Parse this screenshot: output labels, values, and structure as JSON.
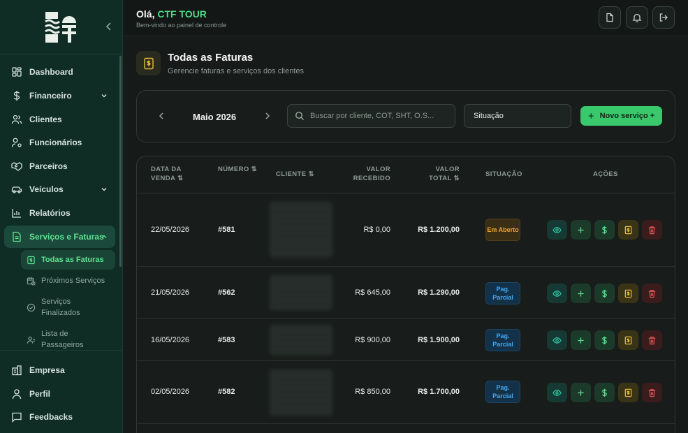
{
  "header": {
    "greeting_prefix": "Olá, ",
    "company": "CTF TOUR",
    "welcome": "Bem-vindo ao painel de controle"
  },
  "sidebar": {
    "items": [
      {
        "label": "Dashboard",
        "icon": "dashboard-icon"
      },
      {
        "label": "Financeiro",
        "icon": "dollar-icon"
      },
      {
        "label": "Clientes",
        "icon": "users-icon"
      },
      {
        "label": "Funcionários",
        "icon": "user-cog-icon"
      },
      {
        "label": "Parceiros",
        "icon": "handshake-icon"
      },
      {
        "label": "Veículos",
        "icon": "car-icon"
      },
      {
        "label": "Relatórios",
        "icon": "bar-chart-icon"
      },
      {
        "label": "Serviços e Faturas",
        "icon": "file-icon"
      }
    ],
    "subitems": [
      {
        "label": "Todas as Faturas"
      },
      {
        "label": "Próximos Serviços"
      },
      {
        "label": "Serviços Finalizados"
      },
      {
        "label": "Lista de Passageiros"
      }
    ],
    "bottom": [
      {
        "label": "Empresa"
      },
      {
        "label": "Perfil"
      },
      {
        "label": "Feedbacks"
      }
    ]
  },
  "page": {
    "title": "Todas as Faturas",
    "subtitle": "Gerencie faturas e serviços dos clientes"
  },
  "filters": {
    "month": "Maio 2026",
    "search_placeholder": "Buscar por cliente, COT, SHT, O.S...",
    "status_label": "Situação",
    "new_button": "Novo serviço +"
  },
  "table": {
    "headers": {
      "date": "DATA DA VENDA ⇅",
      "number": "NÚMERO ⇅",
      "client": "CLIENTE ⇅",
      "received": "VALOR RECEBIDO",
      "total": "VALOR TOTAL ⇅",
      "status": "SITUAÇÃO",
      "actions": "AÇÕES"
    },
    "rows": [
      {
        "date": "22/05/2026",
        "number": "#581",
        "received": "R$ 0,00",
        "total": "R$ 1.200,00",
        "status": "Em Aberto",
        "status_kind": "open"
      },
      {
        "date": "21/05/2026",
        "number": "#562",
        "received": "R$ 645,00",
        "total": "R$ 1.290,00",
        "status": "Pag. Parcial",
        "status_kind": "partial"
      },
      {
        "date": "16/05/2026",
        "number": "#583",
        "received": "R$ 900,00",
        "total": "R$ 1.900,00",
        "status": "Pag. Parcial",
        "status_kind": "partial"
      },
      {
        "date": "02/05/2026",
        "number": "#582",
        "received": "R$ 850,00",
        "total": "R$ 1.700,00",
        "status": "Pag. Parcial",
        "status_kind": "partial"
      }
    ]
  },
  "colors": {
    "brand_green": "#4fd98a",
    "sidebar_bg": "#0f2d25",
    "status_open": "#f0a53a",
    "status_partial": "#3fa9f5"
  }
}
